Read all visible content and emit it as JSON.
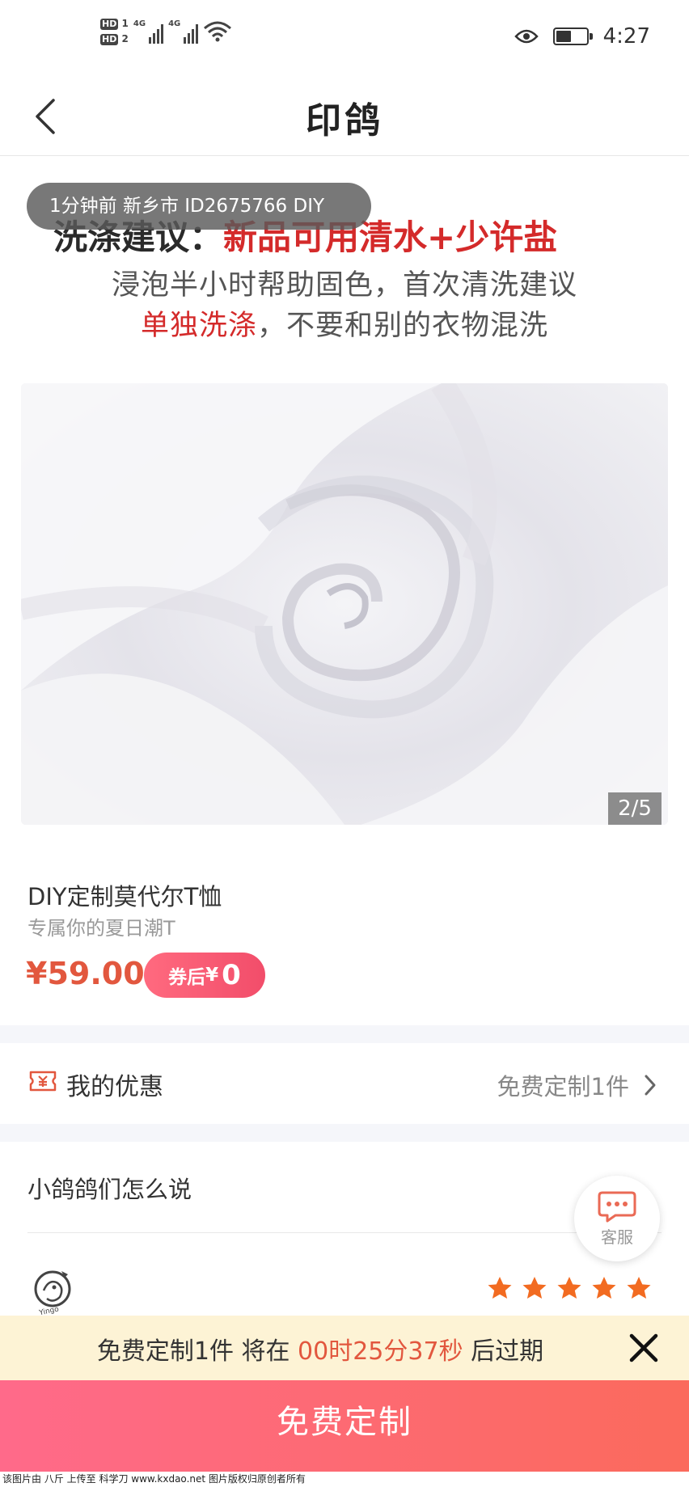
{
  "status_bar": {
    "hd1": "HD",
    "hd1_num": "1",
    "hd2": "HD",
    "hd2_num": "2",
    "net1": "4G",
    "net2": "4G",
    "time": "4:27",
    "battery_level": 0.5
  },
  "nav": {
    "title": "印鸽"
  },
  "advice": {
    "line1_prefix": "洗涤建议：",
    "line1_highlight": "新品可用清水+少许盐",
    "line2": "浸泡半小时帮助固色，首次清洗建议",
    "line3_highlight": "单独洗涤",
    "line3_rest": "，不要和别的衣物混洗"
  },
  "toast": {
    "text": "1分钟前 新乡市 ID2675766 DIY"
  },
  "gallery": {
    "pager": "2/5"
  },
  "product": {
    "title": "DIY定制莫代尔T恤",
    "subtitle": "专属你的夏日潮T",
    "price": "¥59.00",
    "coupon_prefix": "券后",
    "coupon_currency": "¥",
    "coupon_value": "0"
  },
  "offers": {
    "label": "我的优惠",
    "value": "免费定制1件"
  },
  "reviews": {
    "heading": "小鸽鸽们怎么说",
    "rating": 5,
    "avatar_text": "Yingo"
  },
  "service": {
    "label": "客服"
  },
  "banner": {
    "prefix": "免费定制1件 将在 ",
    "countdown": "00时25分37秒",
    "suffix": " 后过期"
  },
  "cta": {
    "label": "免费定制"
  },
  "watermark": {
    "text": "该图片由 八斤 上传至 科学刀 www.kxdao.net 图片版权归原创者所有"
  },
  "colors": {
    "accent": "#e2573e",
    "highlight_red": "#d42a2a",
    "cta_start": "#ff6a8a",
    "cta_end": "#fb6a5c",
    "star": "#f26b21",
    "banner_bg": "#fdf3d5"
  }
}
